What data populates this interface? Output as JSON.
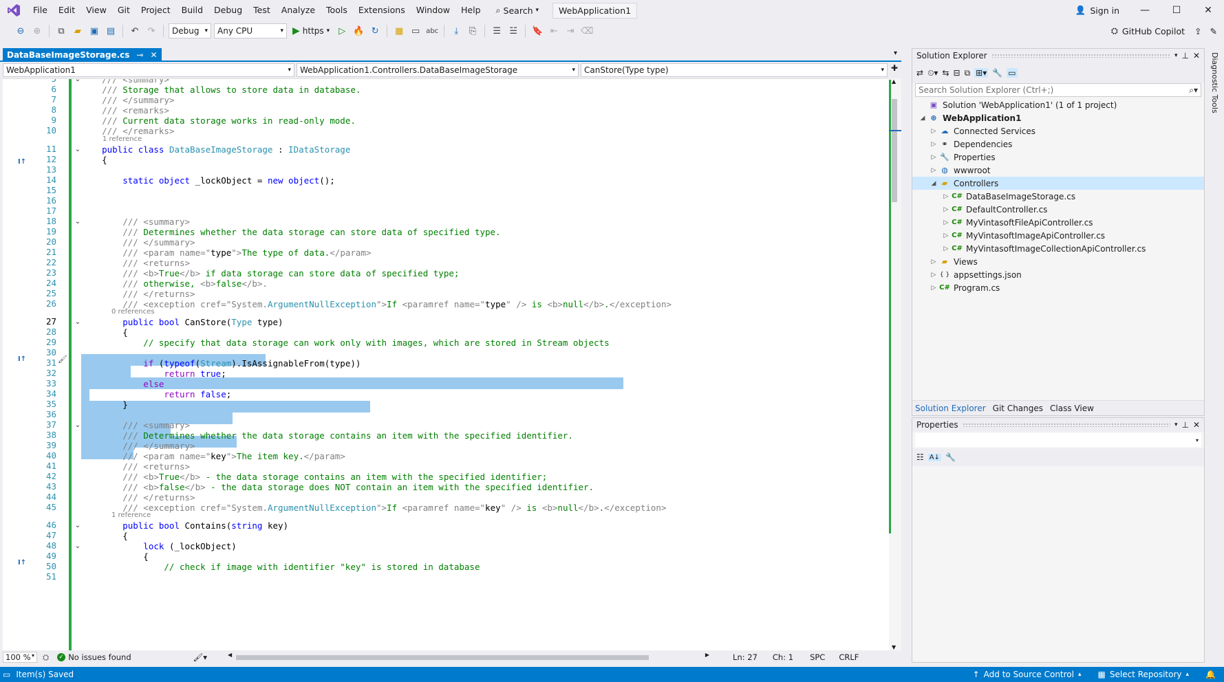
{
  "menu": {
    "items": [
      "File",
      "Edit",
      "View",
      "Git",
      "Project",
      "Build",
      "Debug",
      "Test",
      "Analyze",
      "Tools",
      "Extensions",
      "Window",
      "Help"
    ],
    "search": "Search",
    "project_title": "WebApplication1",
    "sign_in": "Sign in"
  },
  "toolbar": {
    "config": "Debug",
    "platform": "Any CPU",
    "run_target": "https",
    "copilot": "GitHub Copilot"
  },
  "editor": {
    "tab_title": "DataBaseImageStorage.cs",
    "nav_project": "WebApplication1",
    "nav_class": "WebApplication1.Controllers.DataBaseImageStorage",
    "nav_member": "CanStore(Type type)",
    "codelens": {
      "l11": "1 reference",
      "l27": "0 references",
      "l46": "1 reference"
    },
    "status": {
      "zoom": "100 %",
      "issues": "No issues found",
      "ln": "Ln: 27",
      "ch": "Ch: 1",
      "spc": "SPC",
      "crlf": "CRLF"
    }
  },
  "solution_explorer": {
    "title": "Solution Explorer",
    "search_placeholder": "Search Solution Explorer (Ctrl+;)",
    "items": [
      {
        "label": "Solution 'WebApplication1' (1 of 1 project)"
      },
      {
        "label": "WebApplication1"
      },
      {
        "label": "Connected Services"
      },
      {
        "label": "Dependencies"
      },
      {
        "label": "Properties"
      },
      {
        "label": "wwwroot"
      },
      {
        "label": "Controllers"
      },
      {
        "label": "DataBaseImageStorage.cs"
      },
      {
        "label": "DefaultController.cs"
      },
      {
        "label": "MyVintasoftFileApiController.cs"
      },
      {
        "label": "MyVintasoftImageApiController.cs"
      },
      {
        "label": "MyVintasoftImageCollectionApiController.cs"
      },
      {
        "label": "Views"
      },
      {
        "label": "appsettings.json"
      },
      {
        "label": "Program.cs"
      }
    ],
    "tabs": [
      "Solution Explorer",
      "Git Changes",
      "Class View"
    ]
  },
  "properties": {
    "title": "Properties"
  },
  "right_rail": {
    "label": "Diagnostic Tools"
  },
  "statusbar": {
    "saved": "Item(s) Saved",
    "source_control": "Add to Source Control",
    "repo": "Select Repository"
  }
}
